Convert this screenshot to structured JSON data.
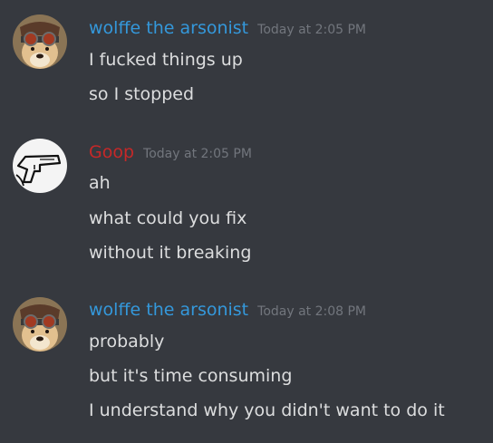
{
  "messages": [
    {
      "author": "wolffe the arsonist",
      "author_color": "#3498db",
      "timestamp": "Today at 2:05 PM",
      "avatar_icon": "shiba-goggles-avatar-icon",
      "lines": [
        "I fucked things up",
        "so I stopped"
      ]
    },
    {
      "author": "Goop",
      "author_color": "#c62828",
      "timestamp": "Today at 2:05 PM",
      "avatar_icon": "hand-gun-sketch-avatar-icon",
      "lines": [
        "ah",
        "what could you fix",
        "without it breaking"
      ]
    },
    {
      "author": "wolffe the arsonist",
      "author_color": "#3498db",
      "timestamp": "Today at 2:08 PM",
      "avatar_icon": "shiba-goggles-avatar-icon",
      "lines": [
        "probably",
        "but it's time consuming",
        "I understand why you didn't want to do it"
      ]
    }
  ]
}
